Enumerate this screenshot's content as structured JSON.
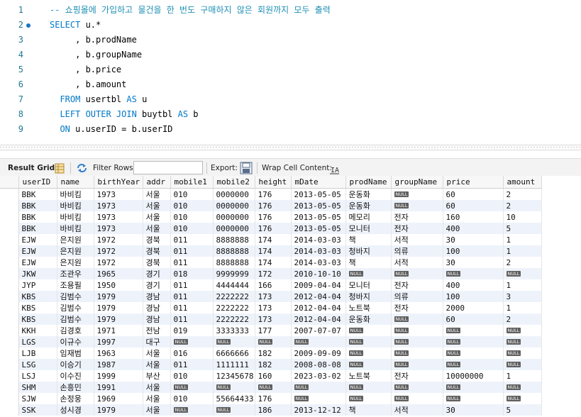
{
  "editor": {
    "lines": [
      {
        "no": "1",
        "tokens": [
          {
            "t": "-- 쇼핑몰에 가입하고 물건을 한 번도 구매하지 않은 회원까지 모두 출력",
            "c": "cm"
          }
        ]
      },
      {
        "no": "2",
        "tokens": [
          {
            "t": "SELECT",
            "c": "kw"
          },
          {
            "t": " u.*",
            "c": ""
          }
        ],
        "marker": true
      },
      {
        "no": "3",
        "tokens": [
          {
            "t": "     , b.prodName",
            "c": ""
          }
        ]
      },
      {
        "no": "4",
        "tokens": [
          {
            "t": "     , b.groupName",
            "c": ""
          }
        ]
      },
      {
        "no": "5",
        "tokens": [
          {
            "t": "     , b.price",
            "c": ""
          }
        ]
      },
      {
        "no": "6",
        "tokens": [
          {
            "t": "     , b.amount",
            "c": ""
          }
        ]
      },
      {
        "no": "7",
        "tokens": [
          {
            "t": "  ",
            "c": ""
          },
          {
            "t": "FROM",
            "c": "kw"
          },
          {
            "t": " usertbl ",
            "c": ""
          },
          {
            "t": "AS",
            "c": "kw"
          },
          {
            "t": " u",
            "c": ""
          }
        ]
      },
      {
        "no": "8",
        "tokens": [
          {
            "t": "  ",
            "c": ""
          },
          {
            "t": "LEFT OUTER JOIN",
            "c": "kw"
          },
          {
            "t": " buytbl ",
            "c": ""
          },
          {
            "t": "AS",
            "c": "kw"
          },
          {
            "t": " b",
            "c": ""
          }
        ]
      },
      {
        "no": "9",
        "tokens": [
          {
            "t": "  ",
            "c": ""
          },
          {
            "t": "ON",
            "c": "kw"
          },
          {
            "t": " u.userID = b.userID",
            "c": ""
          }
        ]
      }
    ]
  },
  "toolbar": {
    "result_grid": "Result Grid",
    "filter_rows": "Filter Rows:",
    "filter_value": "",
    "export": "Export:",
    "wrap": "Wrap Cell Content:",
    "icons": [
      "grid-view-icon",
      "refresh-icon",
      "export-icon",
      "wrap-icon"
    ]
  },
  "grid": {
    "columns": [
      "userID",
      "name",
      "birthYear",
      "addr",
      "mobile1",
      "mobile2",
      "height",
      "mDate",
      "prodName",
      "groupName",
      "price",
      "amount"
    ],
    "null_label": "NULL",
    "rows": [
      [
        "BBK",
        "바비킴",
        "1973",
        "서울",
        "010",
        "0000000",
        "176",
        "2013-05-05",
        "운동화",
        null,
        "60",
        "2"
      ],
      [
        "BBK",
        "바비킴",
        "1973",
        "서울",
        "010",
        "0000000",
        "176",
        "2013-05-05",
        "운동화",
        null,
        "60",
        "2"
      ],
      [
        "BBK",
        "바비킴",
        "1973",
        "서울",
        "010",
        "0000000",
        "176",
        "2013-05-05",
        "메모리",
        "전자",
        "160",
        "10"
      ],
      [
        "BBK",
        "바비킴",
        "1973",
        "서울",
        "010",
        "0000000",
        "176",
        "2013-05-05",
        "모니터",
        "전자",
        "400",
        "5"
      ],
      [
        "EJW",
        "은지원",
        "1972",
        "경북",
        "011",
        "8888888",
        "174",
        "2014-03-03",
        "책",
        "서적",
        "30",
        "1"
      ],
      [
        "EJW",
        "은지원",
        "1972",
        "경북",
        "011",
        "8888888",
        "174",
        "2014-03-03",
        "청바지",
        "의류",
        "100",
        "1"
      ],
      [
        "EJW",
        "은지원",
        "1972",
        "경북",
        "011",
        "8888888",
        "174",
        "2014-03-03",
        "책",
        "서적",
        "30",
        "2"
      ],
      [
        "JKW",
        "조관우",
        "1965",
        "경기",
        "018",
        "9999999",
        "172",
        "2010-10-10",
        null,
        null,
        null,
        null
      ],
      [
        "JYP",
        "조용필",
        "1950",
        "경기",
        "011",
        "4444444",
        "166",
        "2009-04-04",
        "모니터",
        "전자",
        "400",
        "1"
      ],
      [
        "KBS",
        "김범수",
        "1979",
        "경남",
        "011",
        "2222222",
        "173",
        "2012-04-04",
        "청바지",
        "의류",
        "100",
        "3"
      ],
      [
        "KBS",
        "김범수",
        "1979",
        "경남",
        "011",
        "2222222",
        "173",
        "2012-04-04",
        "노트북",
        "전자",
        "2000",
        "1"
      ],
      [
        "KBS",
        "김범수",
        "1979",
        "경남",
        "011",
        "2222222",
        "173",
        "2012-04-04",
        "운동화",
        null,
        "60",
        "2"
      ],
      [
        "KKH",
        "김경호",
        "1971",
        "전남",
        "019",
        "3333333",
        "177",
        "2007-07-07",
        null,
        null,
        null,
        null
      ],
      [
        "LGS",
        "이규수",
        "1997",
        "대구",
        null,
        null,
        null,
        null,
        null,
        null,
        null,
        null
      ],
      [
        "LJB",
        "임재범",
        "1963",
        "서울",
        "016",
        "6666666",
        "182",
        "2009-09-09",
        null,
        null,
        null,
        null
      ],
      [
        "LSG",
        "이승기",
        "1987",
        "서울",
        "011",
        "1111111",
        "182",
        "2008-08-08",
        null,
        null,
        null,
        null
      ],
      [
        "LSJ",
        "이수진",
        "1999",
        "부산",
        "010",
        "12345678",
        "160",
        "2023-03-02",
        "노트북",
        "전자",
        "10000000",
        "1"
      ],
      [
        "SHM",
        "손흥민",
        "1991",
        "서울",
        null,
        null,
        null,
        null,
        null,
        null,
        null,
        null
      ],
      [
        "SJW",
        "손정웅",
        "1969",
        "서울",
        "010",
        "55664433",
        "176",
        null,
        null,
        null,
        null,
        null
      ],
      [
        "SSK",
        "성시경",
        "1979",
        "서울",
        null,
        null,
        "186",
        "2013-12-12",
        "책",
        "서적",
        "30",
        "5"
      ]
    ]
  }
}
